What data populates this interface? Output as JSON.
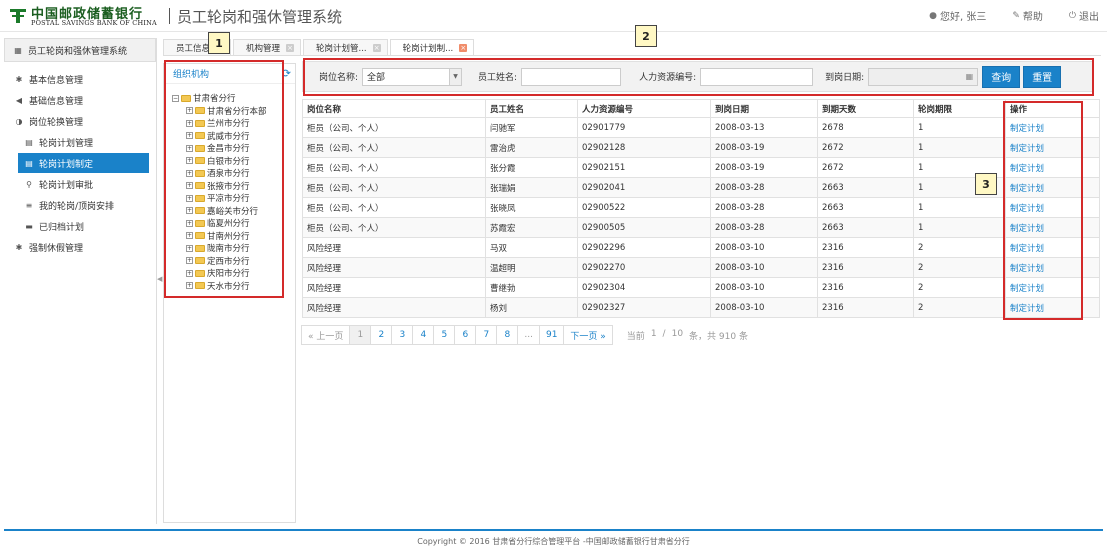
{
  "header": {
    "logo_cn": "中国邮政储蓄银行",
    "logo_en": "POSTAL SAVINGS BANK OF CHINA",
    "app_title": "员工轮岗和强休管理系统",
    "greeting": "您好, 张三",
    "help": "帮助",
    "logout": "退出",
    "brand_color": "#1b5e20"
  },
  "sidebar": {
    "title": "员工轮岗和强休管理系统",
    "items": [
      {
        "label": "基本信息管理",
        "icon": "asterisk-icon"
      },
      {
        "label": "基础信息管理",
        "icon": "megaphone-icon"
      },
      {
        "label": "岗位轮换管理",
        "icon": "half-circle-icon"
      },
      {
        "label": "轮岗计划管理",
        "icon": "chart-icon"
      },
      {
        "label": "轮岗计划制定",
        "icon": "chart-icon"
      },
      {
        "label": "轮岗计划审批",
        "icon": "search-icon"
      },
      {
        "label": "我的轮岗/顶岗安排",
        "icon": "list-icon"
      },
      {
        "label": "已归档计划",
        "icon": "briefcase-icon"
      },
      {
        "label": "强制休假管理",
        "icon": "asterisk-icon"
      }
    ]
  },
  "tabs": [
    {
      "label": "员工信息"
    },
    {
      "label": "机构管理"
    },
    {
      "label": "轮岗计划管..."
    },
    {
      "label": "轮岗计划制..."
    }
  ],
  "org": {
    "title": "组织机构",
    "root": "甘肃省分行",
    "children": [
      "甘肃省分行本部",
      "兰州市分行",
      "武威市分行",
      "金昌市分行",
      "白银市分行",
      "酒泉市分行",
      "张掖市分行",
      "平凉市分行",
      "嘉峪关市分行",
      "临夏州分行",
      "甘南州分行",
      "陇南市分行",
      "定西市分行",
      "庆阳市分行",
      "天水市分行"
    ]
  },
  "search": {
    "position_label": "岗位名称:",
    "position_value": "全部",
    "name_label": "员工姓名:",
    "hr_label": "人力资源编号:",
    "date_label": "到岗日期:",
    "query": "查询",
    "reset": "重置"
  },
  "table": {
    "headers": [
      "岗位名称",
      "员工姓名",
      "人力资源编号",
      "到岗日期",
      "到期天数",
      "轮岗期限",
      "操作"
    ],
    "rows": [
      [
        "柜员（公司、个人）",
        "闫驰军",
        "02901779",
        "2008-03-13",
        "2678",
        "1",
        "制定计划"
      ],
      [
        "柜员（公司、个人）",
        "雷治虎",
        "02902128",
        "2008-03-19",
        "2672",
        "1",
        "制定计划"
      ],
      [
        "柜员（公司、个人）",
        "张分霞",
        "02902151",
        "2008-03-19",
        "2672",
        "1",
        "制定计划"
      ],
      [
        "柜员（公司、个人）",
        "张瑞娟",
        "02902041",
        "2008-03-28",
        "2663",
        "1",
        "制定计划"
      ],
      [
        "柜员（公司、个人）",
        "张晓凤",
        "02900522",
        "2008-03-28",
        "2663",
        "1",
        "制定计划"
      ],
      [
        "柜员（公司、个人）",
        "苏霞宏",
        "02900505",
        "2008-03-28",
        "2663",
        "1",
        "制定计划"
      ],
      [
        "风险经理",
        "马双",
        "02902296",
        "2008-03-10",
        "2316",
        "2",
        "制定计划"
      ],
      [
        "风险经理",
        "温超明",
        "02902270",
        "2008-03-10",
        "2316",
        "2",
        "制定计划"
      ],
      [
        "风险经理",
        "曹继勃",
        "02902304",
        "2008-03-10",
        "2316",
        "2",
        "制定计划"
      ],
      [
        "风险经理",
        "杨刘",
        "02902327",
        "2008-03-10",
        "2316",
        "2",
        "制定计划"
      ]
    ]
  },
  "pager": {
    "prev": "« 上一页",
    "pages": [
      "1",
      "2",
      "3",
      "4",
      "5",
      "6",
      "7",
      "8",
      "...",
      "91"
    ],
    "next": "下一页 »",
    "current_label": "当前",
    "current": "1",
    "sep": "/",
    "total_pages": "10",
    "summary": "条，共 910 条"
  },
  "annotations": [
    "1",
    "2",
    "3"
  ],
  "footer": "Copyright © 2016 甘肃省分行综合管理平台 -中国邮政储蓄银行甘肃省分行"
}
